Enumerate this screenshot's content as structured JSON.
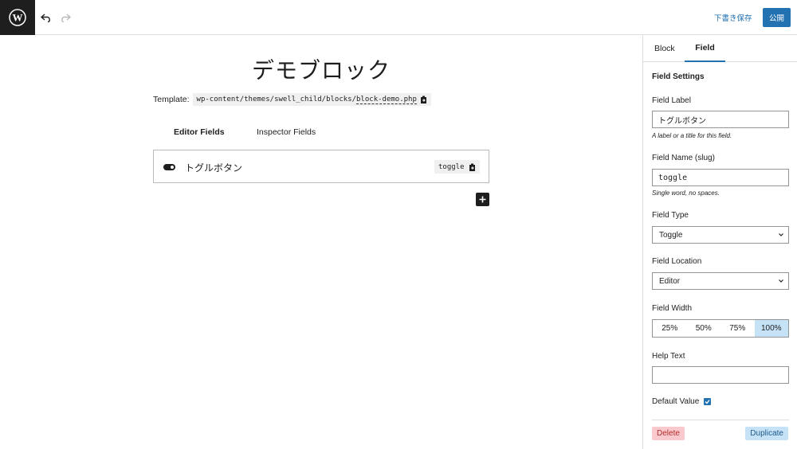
{
  "header": {
    "logo_icon": "wordpress-logo-icon",
    "save_draft_label": "下書き保存",
    "publish_label": "公開",
    "accent_color": "#2271b1"
  },
  "editor": {
    "title": "デモブロック",
    "template_label": "Template:",
    "template_path_prefix": "wp-content/themes/swell_child/blocks/",
    "template_file": "block-demo.php",
    "tabs": [
      {
        "label": "Editor Fields",
        "active": true
      },
      {
        "label": "Inspector Fields",
        "active": false
      }
    ],
    "fields": [
      {
        "label": "トグルボタン",
        "slug": "toggle",
        "icon": "toggle-icon"
      }
    ]
  },
  "sidebar": {
    "tabs": [
      {
        "label": "Block",
        "active": false
      },
      {
        "label": "Field",
        "active": true
      }
    ],
    "heading": "Field Settings",
    "field_label": {
      "label": "Field Label",
      "value": "トグルボタン",
      "help": "A label or a title for this field."
    },
    "field_name": {
      "label": "Field Name (slug)",
      "value": "toggle",
      "help": "Single word, no spaces."
    },
    "field_type": {
      "label": "Field Type",
      "value": "Toggle"
    },
    "field_location": {
      "label": "Field Location",
      "value": "Editor"
    },
    "field_width": {
      "label": "Field Width",
      "options": [
        "25%",
        "50%",
        "75%",
        "100%"
      ],
      "selected": "100%"
    },
    "help_text": {
      "label": "Help Text",
      "value": ""
    },
    "default_value": {
      "label": "Default Value",
      "checked": true
    },
    "delete_label": "Delete",
    "duplicate_label": "Duplicate"
  }
}
